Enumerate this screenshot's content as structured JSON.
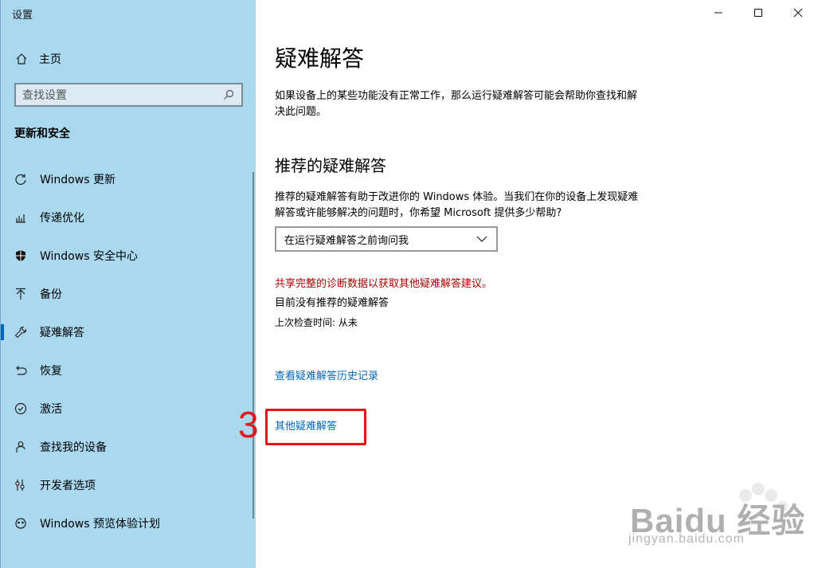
{
  "window": {
    "title": "设置"
  },
  "sidebar": {
    "home_label": "主页",
    "search_placeholder": "查找设置",
    "section_title": "更新和安全",
    "items": [
      {
        "label": "Windows 更新",
        "icon": "refresh-icon"
      },
      {
        "label": "传递优化",
        "icon": "delivery-icon"
      },
      {
        "label": "Windows 安全中心",
        "icon": "shield-icon"
      },
      {
        "label": "备份",
        "icon": "backup-icon"
      },
      {
        "label": "疑难解答",
        "icon": "wrench-icon",
        "active": true
      },
      {
        "label": "恢复",
        "icon": "recovery-icon"
      },
      {
        "label": "激活",
        "icon": "check-circle-icon"
      },
      {
        "label": "查找我的设备",
        "icon": "person-pin-icon"
      },
      {
        "label": "开发者选项",
        "icon": "developer-icon"
      },
      {
        "label": "Windows 预览体验计划",
        "icon": "insider-icon"
      }
    ]
  },
  "main": {
    "title": "疑难解答",
    "intro": "如果设备上的某些功能没有正常工作，那么运行疑难解答可能会帮助你查找和解决此问题。",
    "recommended_heading": "推荐的疑难解答",
    "recommended_desc": "推荐的疑难解答有助于改进你的 Windows 体验。当我们在你的设备上发现疑难解答或许能够解决的问题时，你希望 Microsoft 提供多少帮助?",
    "dropdown_value": "在运行疑难解答之前询问我",
    "share_link": "共享完整的诊断数据以获取其他疑难解答建议。",
    "no_recommended": "目前没有推荐的疑难解答",
    "last_checked": "上次检查时间: 从未",
    "history_link": "查看疑难解答历史记录",
    "other_link": "其他疑难解答"
  },
  "annotation": {
    "step_number": "3",
    "color": "#e8141a"
  },
  "watermark": {
    "brand": "Baidu 经验",
    "url": "jingyan.baidu.com"
  },
  "colors": {
    "sidebar_bg": "#a9d8ef",
    "accent": "#0067b8",
    "warning_red": "#b00000"
  }
}
